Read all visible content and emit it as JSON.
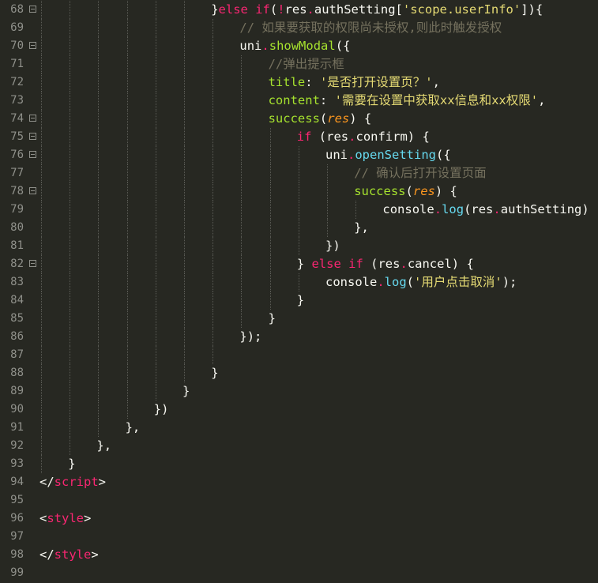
{
  "editor": {
    "theme_colors": {
      "background": "#272822",
      "gutter_text": "#8f908a",
      "keyword": "#f92672",
      "function": "#66d9ef",
      "string": "#e6db74",
      "comment": "#75715e",
      "property": "#a6e22e",
      "parameter": "#fd971f",
      "plain": "#f8f8f2"
    },
    "lines": [
      {
        "num": "68",
        "fold": true,
        "indent": 6,
        "tokens": [
          {
            "t": "pl",
            "v": "}"
          },
          {
            "t": "kw",
            "v": "else if"
          },
          {
            "t": "pl",
            "v": "("
          },
          {
            "t": "kw",
            "v": "!"
          },
          {
            "t": "pl",
            "v": "res"
          },
          {
            "t": "dot",
            "v": "."
          },
          {
            "t": "pl",
            "v": "authSetting["
          },
          {
            "t": "str",
            "v": "'scope.userInfo'"
          },
          {
            "t": "pl",
            "v": "]){"
          }
        ]
      },
      {
        "num": "69",
        "fold": false,
        "indent": 7,
        "tokens": [
          {
            "t": "cm",
            "v": "// 如果要获取的权限尚未授权,则此时触发授权"
          }
        ]
      },
      {
        "num": "70",
        "fold": true,
        "indent": 7,
        "tokens": [
          {
            "t": "pl",
            "v": "uni"
          },
          {
            "t": "dot",
            "v": "."
          },
          {
            "t": "prop",
            "v": "showModal"
          },
          {
            "t": "pl",
            "v": "({"
          }
        ]
      },
      {
        "num": "71",
        "fold": false,
        "indent": 8,
        "tokens": [
          {
            "t": "cm",
            "v": "//弹出提示框"
          }
        ]
      },
      {
        "num": "72",
        "fold": false,
        "indent": 8,
        "tokens": [
          {
            "t": "prop",
            "v": "title"
          },
          {
            "t": "pl",
            "v": ": "
          },
          {
            "t": "str",
            "v": "'是否打开设置页？'"
          },
          {
            "t": "pl",
            "v": ","
          }
        ]
      },
      {
        "num": "73",
        "fold": false,
        "indent": 8,
        "tokens": [
          {
            "t": "prop",
            "v": "content"
          },
          {
            "t": "pl",
            "v": ": "
          },
          {
            "t": "str",
            "v": "'需要在设置中获取xx信息和xx权限'"
          },
          {
            "t": "pl",
            "v": ","
          }
        ]
      },
      {
        "num": "74",
        "fold": true,
        "indent": 8,
        "tokens": [
          {
            "t": "prop",
            "v": "success"
          },
          {
            "t": "pl",
            "v": "("
          },
          {
            "t": "param",
            "v": "res"
          },
          {
            "t": "pl",
            "v": ") {"
          }
        ]
      },
      {
        "num": "75",
        "fold": true,
        "indent": 9,
        "tokens": [
          {
            "t": "kw",
            "v": "if"
          },
          {
            "t": "pl",
            "v": " (res"
          },
          {
            "t": "dot",
            "v": "."
          },
          {
            "t": "pl",
            "v": "confirm) {"
          }
        ]
      },
      {
        "num": "76",
        "fold": true,
        "indent": 10,
        "tokens": [
          {
            "t": "pl",
            "v": "uni"
          },
          {
            "t": "dot",
            "v": "."
          },
          {
            "t": "fn",
            "v": "openSetting"
          },
          {
            "t": "pl",
            "v": "({"
          }
        ]
      },
      {
        "num": "77",
        "fold": false,
        "indent": 11,
        "tokens": [
          {
            "t": "cm",
            "v": "// 确认后打开设置页面"
          }
        ]
      },
      {
        "num": "78",
        "fold": true,
        "indent": 11,
        "tokens": [
          {
            "t": "prop",
            "v": "success"
          },
          {
            "t": "pl",
            "v": "("
          },
          {
            "t": "param",
            "v": "res"
          },
          {
            "t": "pl",
            "v": ") {"
          }
        ]
      },
      {
        "num": "79",
        "fold": false,
        "indent": 12,
        "tokens": [
          {
            "t": "pl",
            "v": "console"
          },
          {
            "t": "dot",
            "v": "."
          },
          {
            "t": "fn",
            "v": "log"
          },
          {
            "t": "pl",
            "v": "(res"
          },
          {
            "t": "dot",
            "v": "."
          },
          {
            "t": "pl",
            "v": "authSetting)"
          }
        ]
      },
      {
        "num": "80",
        "fold": false,
        "indent": 11,
        "tokens": [
          {
            "t": "pl",
            "v": "},"
          }
        ]
      },
      {
        "num": "81",
        "fold": false,
        "indent": 10,
        "tokens": [
          {
            "t": "pl",
            "v": "})"
          }
        ]
      },
      {
        "num": "82",
        "fold": true,
        "indent": 9,
        "tokens": [
          {
            "t": "pl",
            "v": "} "
          },
          {
            "t": "kw",
            "v": "else if"
          },
          {
            "t": "pl",
            "v": " (res"
          },
          {
            "t": "dot",
            "v": "."
          },
          {
            "t": "pl",
            "v": "cancel) {"
          }
        ]
      },
      {
        "num": "83",
        "fold": false,
        "indent": 10,
        "tokens": [
          {
            "t": "pl",
            "v": "console"
          },
          {
            "t": "dot",
            "v": "."
          },
          {
            "t": "fn",
            "v": "log"
          },
          {
            "t": "pl",
            "v": "("
          },
          {
            "t": "str",
            "v": "'用户点击取消'"
          },
          {
            "t": "pl",
            "v": ");"
          }
        ]
      },
      {
        "num": "84",
        "fold": false,
        "indent": 9,
        "tokens": [
          {
            "t": "pl",
            "v": "}"
          }
        ]
      },
      {
        "num": "85",
        "fold": false,
        "indent": 8,
        "tokens": [
          {
            "t": "pl",
            "v": "}"
          }
        ]
      },
      {
        "num": "86",
        "fold": false,
        "indent": 7,
        "tokens": [
          {
            "t": "pl",
            "v": "});"
          }
        ]
      },
      {
        "num": "87",
        "fold": false,
        "indent": 7,
        "tokens": []
      },
      {
        "num": "88",
        "fold": false,
        "indent": 6,
        "tokens": [
          {
            "t": "pl",
            "v": "}"
          }
        ]
      },
      {
        "num": "89",
        "fold": false,
        "indent": 5,
        "tokens": [
          {
            "t": "pl",
            "v": "}"
          }
        ]
      },
      {
        "num": "90",
        "fold": false,
        "indent": 4,
        "tokens": [
          {
            "t": "pl",
            "v": "})"
          }
        ]
      },
      {
        "num": "91",
        "fold": false,
        "indent": 3,
        "tokens": [
          {
            "t": "pl",
            "v": "},"
          }
        ]
      },
      {
        "num": "92",
        "fold": false,
        "indent": 2,
        "tokens": [
          {
            "t": "pl",
            "v": "},"
          }
        ]
      },
      {
        "num": "93",
        "fold": false,
        "indent": 1,
        "tokens": [
          {
            "t": "pl",
            "v": "}"
          }
        ]
      },
      {
        "num": "94",
        "fold": false,
        "indent": 0,
        "tokens": [
          {
            "t": "pl",
            "v": "</"
          },
          {
            "t": "tag",
            "v": "script"
          },
          {
            "t": "pl",
            "v": ">"
          }
        ]
      },
      {
        "num": "95",
        "fold": false,
        "indent": 0,
        "tokens": []
      },
      {
        "num": "96",
        "fold": false,
        "indent": 0,
        "tokens": [
          {
            "t": "pl",
            "v": "<"
          },
          {
            "t": "tag",
            "v": "style"
          },
          {
            "t": "pl",
            "v": ">"
          }
        ]
      },
      {
        "num": "97",
        "fold": false,
        "indent": 0,
        "tokens": []
      },
      {
        "num": "98",
        "fold": false,
        "indent": 0,
        "tokens": [
          {
            "t": "pl",
            "v": "</"
          },
          {
            "t": "tag",
            "v": "style"
          },
          {
            "t": "pl",
            "v": ">"
          }
        ]
      },
      {
        "num": "99",
        "fold": false,
        "indent": 0,
        "tokens": []
      }
    ]
  }
}
